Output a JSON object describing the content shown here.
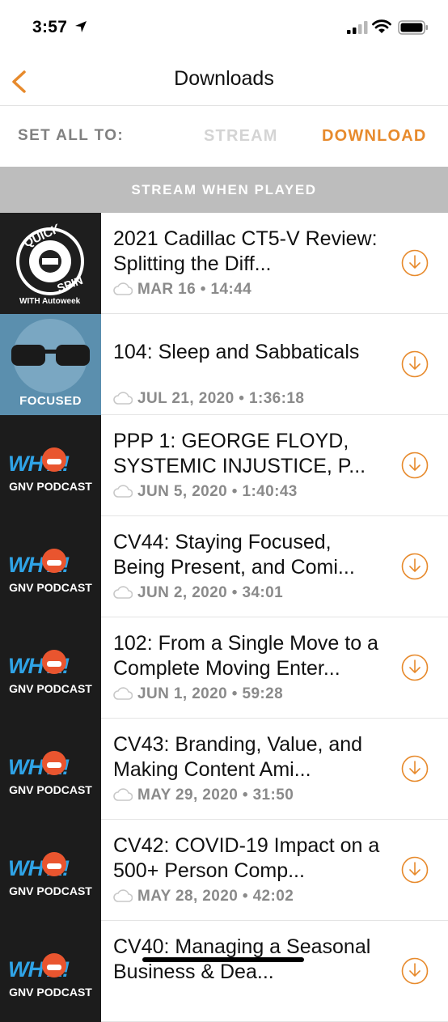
{
  "status_bar": {
    "time": "3:57"
  },
  "nav": {
    "title": "Downloads"
  },
  "set_all": {
    "label": "SET ALL TO:",
    "stream": "STREAM",
    "download": "DOWNLOAD",
    "selected": "DOWNLOAD"
  },
  "section": {
    "title": "STREAM WHEN PLAYED"
  },
  "artwork_text": {
    "quickspin": {
      "quick": "QUICK",
      "spin": "SPIN",
      "brand": "WITH Autoweek"
    },
    "focused": {
      "name": "FOCUSED"
    },
    "whoa": {
      "brand": "WH  A!",
      "name": "GNV PODCAST"
    }
  },
  "episodes": [
    {
      "title": "2021 Cadillac CT5-V Review: Splitting the Diff...",
      "meta": "MAR 16 • 14:44",
      "artwork": "quickspin"
    },
    {
      "title": "104: Sleep and Sabbaticals",
      "meta": "JUL 21, 2020 • 1:36:18",
      "artwork": "focused"
    },
    {
      "title": "PPP 1: GEORGE FLOYD, SYSTEMIC INJUSTICE, P...",
      "meta": "JUN 5, 2020 • 1:40:43",
      "artwork": "whoa"
    },
    {
      "title": "CV44: Staying Focused, Being Present, and Comi...",
      "meta": "JUN 2, 2020 • 34:01",
      "artwork": "whoa"
    },
    {
      "title": "102: From a Single Move to a Complete Moving Enter...",
      "meta": "JUN 1, 2020 • 59:28",
      "artwork": "whoa"
    },
    {
      "title": "CV43: Branding, Value, and Making Content Ami...",
      "meta": "MAY 29, 2020 • 31:50",
      "artwork": "whoa"
    },
    {
      "title": "CV42: COVID-19 Impact on a 500+ Person Comp...",
      "meta": "MAY 28, 2020 • 42:02",
      "artwork": "whoa"
    },
    {
      "title": "CV40: Managing a Seasonal Business & Dea...",
      "meta": "",
      "artwork": "whoa"
    }
  ],
  "colors": {
    "accent": "#e78a2c",
    "section_bg": "#bdbdbd",
    "meta_gray": "#8a8a8a"
  },
  "icons": {
    "back": "chevron-left-icon",
    "download": "download-circle-icon",
    "cloud": "cloud-icon"
  }
}
